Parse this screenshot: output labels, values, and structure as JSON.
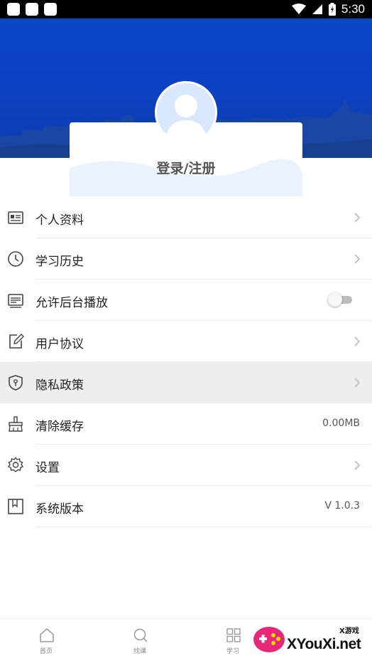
{
  "status_bar": {
    "time": "5:30",
    "icons": [
      "app-square-icon",
      "app-square-icon",
      "app-square-icon",
      "wifi-icon",
      "signal-icon",
      "battery-icon"
    ]
  },
  "header": {
    "login_text": "登录/注册",
    "background_color": "#0c41c0"
  },
  "menu": {
    "items": [
      {
        "label": "个人资料",
        "icon": "profile-card-icon",
        "trailing": "chevron"
      },
      {
        "label": "学习历史",
        "icon": "clock-icon",
        "trailing": "chevron"
      },
      {
        "label": "允许后台播放",
        "icon": "keyboard-icon",
        "trailing": "toggle",
        "toggle_on": false
      },
      {
        "label": "用户协议",
        "icon": "edit-document-icon",
        "trailing": "chevron"
      },
      {
        "label": "隐私政策",
        "icon": "shield-icon",
        "trailing": "chevron",
        "highlighted": true
      },
      {
        "label": "清除缓存",
        "icon": "broom-icon",
        "trailing": "value",
        "value": "0.00MB"
      },
      {
        "label": "设置",
        "icon": "gear-icon",
        "trailing": "chevron"
      },
      {
        "label": "系统版本",
        "icon": "bookmark-icon",
        "trailing": "value",
        "value": "V 1.0.3"
      }
    ]
  },
  "bottom_nav": {
    "items": [
      {
        "label": "首页",
        "icon": "home-icon"
      },
      {
        "label": "找课",
        "icon": "search-icon"
      },
      {
        "label": "学习",
        "icon": "grid-icon"
      }
    ]
  },
  "watermark": {
    "top_text": "X游戏",
    "main_text": "XYouXi.net"
  }
}
